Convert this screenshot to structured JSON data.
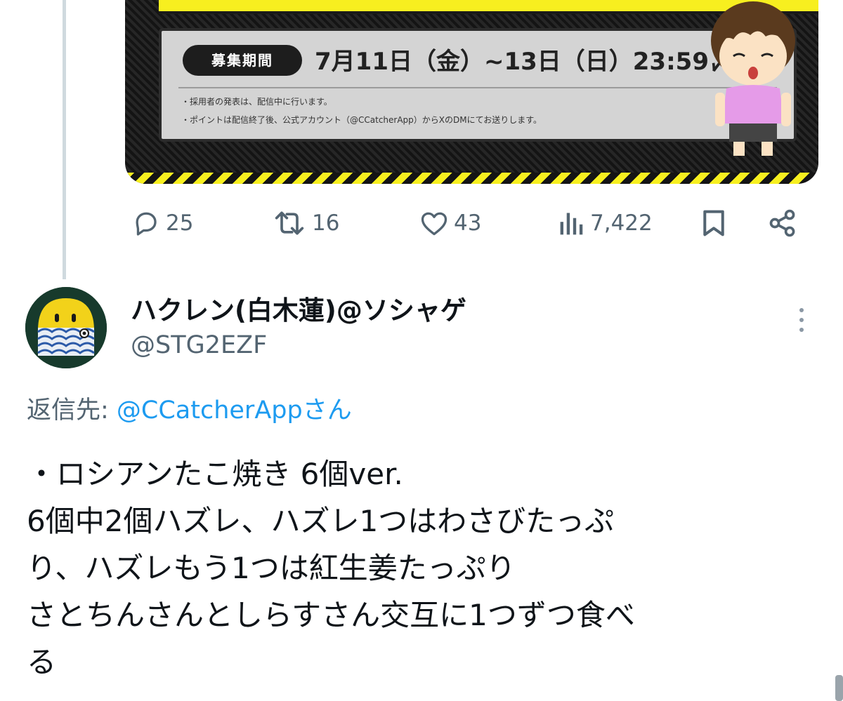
{
  "media": {
    "period_label": "募集期間",
    "period_dates": "7月11日（金）~13日（日）23:59〆",
    "notes": [
      "・採用者の発表は、配信中に行います。",
      "・ポイントは配信終了後、公式アカウント（@CCatcherApp）からXのDMにてお送りします。"
    ]
  },
  "actions": {
    "replies": "25",
    "reposts": "16",
    "likes": "43",
    "views": "7,422"
  },
  "reply_tweet": {
    "display_name": "ハクレン(白木蓮)@ソシャゲ",
    "handle": "@STG2EZF",
    "reply_to_prefix": "返信先: ",
    "reply_to_mention": "@CCatcherAppさん",
    "body_lines": [
      "・ロシアンたこ焼き 6個ver.",
      "6個中2個ハズレ、ハズレ1つはわさびたっぷ",
      "り、ハズレもう1つは紅生姜たっぷり",
      "さとちんさんとしらすさん交互に1つずつ食べ",
      "る"
    ]
  },
  "colors": {
    "text": "#0f1419",
    "secondary": "#536471",
    "link": "#1d9bf0",
    "promo_yellow": "#f7ef1f"
  },
  "icons": [
    "reply-icon",
    "repost-icon",
    "like-icon",
    "views-icon",
    "bookmark-icon",
    "share-icon",
    "more-icon"
  ]
}
